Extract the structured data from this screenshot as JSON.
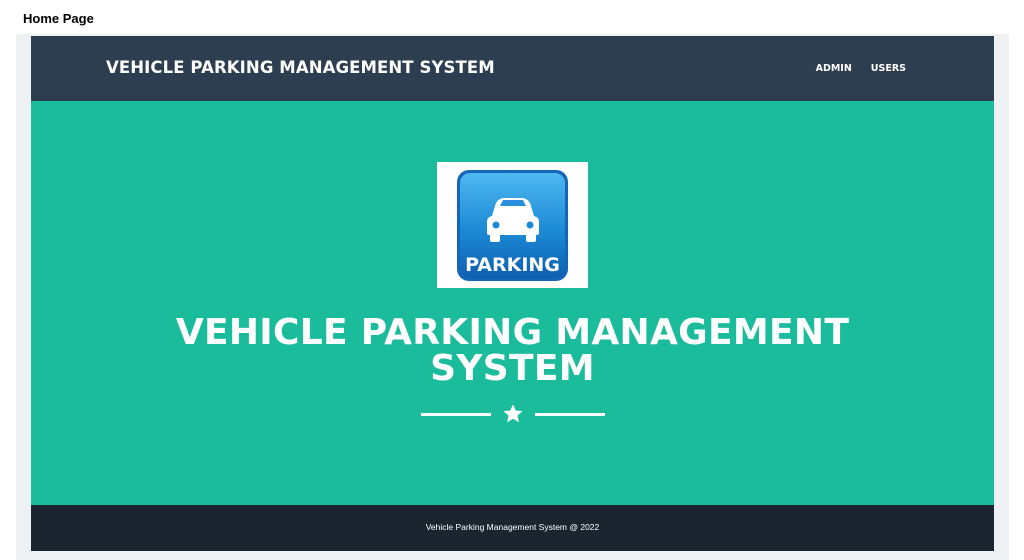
{
  "caption": "Home Page",
  "navbar": {
    "brand": "VEHICLE PARKING MANAGEMENT SYSTEM",
    "links": [
      "ADMIN",
      "USERS"
    ]
  },
  "masthead": {
    "logo": {
      "icon": "car-icon",
      "label": "PARKING"
    },
    "heading_line1": "VEHICLE PARKING MANAGEMENT",
    "heading_line2": "SYSTEM",
    "divider_icon": "star-icon"
  },
  "footer": {
    "text": "Vehicle Parking Management System @ 2022"
  },
  "colors": {
    "navbar": "#2c3e50",
    "masthead": "#1abc9c",
    "footer": "#1a252f",
    "logo_blue": "#1e8fd8"
  }
}
